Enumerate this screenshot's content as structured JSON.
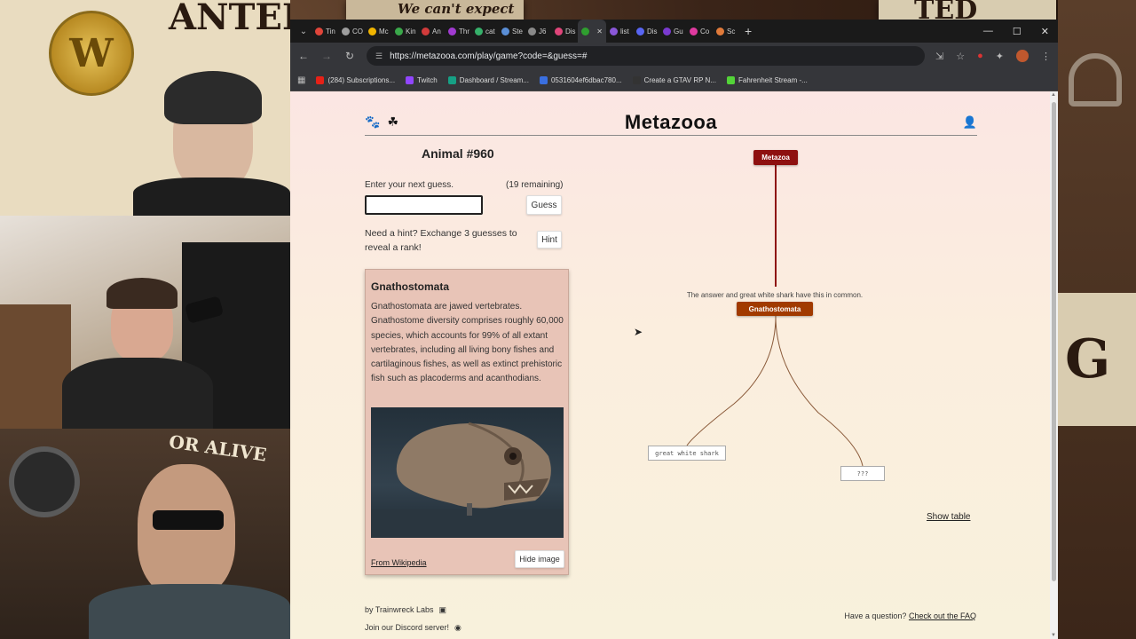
{
  "overlay": {
    "poster_text_top": "ANTED",
    "poster_text_top_right": "TED",
    "sign_text": "We can't expect",
    "poster_text_bottom": "OR ALIVE",
    "poster_text_side": "G",
    "badge_text": "W"
  },
  "browser": {
    "tabs": [
      {
        "label": "Tin",
        "color": "#e0453a"
      },
      {
        "label": "CO",
        "color": "#9e9e9e"
      },
      {
        "label": "Mc",
        "color": "#f0b400"
      },
      {
        "label": "Kin",
        "color": "#3aa84a"
      },
      {
        "label": "An",
        "color": "#d23b3b"
      },
      {
        "label": "Thr",
        "color": "#a03ad0"
      },
      {
        "label": "cat",
        "color": "#36b06a"
      },
      {
        "label": "Ste",
        "color": "#5a8ed6"
      },
      {
        "label": "J6",
        "color": "#8a8a8a"
      },
      {
        "label": "Dis",
        "color": "#e0457a"
      },
      {
        "label": "",
        "color": "#2f9e2f",
        "active": true
      },
      {
        "label": "list",
        "color": "#8a57d8"
      },
      {
        "label": "Dis",
        "color": "#5865f2"
      },
      {
        "label": "Gu",
        "color": "#7a3ad0"
      },
      {
        "label": "Co",
        "color": "#e03aa0"
      },
      {
        "label": "Sc",
        "color": "#e07a3a"
      }
    ],
    "close_tab_glyph": "✕",
    "new_tab_glyph": "+",
    "url": "https://metazooa.com/play/game?code=&guess=#",
    "bookmarks": [
      {
        "label": "(284) Subscriptions...",
        "color": "#e62117"
      },
      {
        "label": "Twitch",
        "color": "#9146ff"
      },
      {
        "label": "Dashboard / Stream...",
        "color": "#16a085"
      },
      {
        "label": "0531604ef6dbac780...",
        "color": "#3a6fe0"
      },
      {
        "label": "Create a GTAV RP N...",
        "color": "#333333"
      },
      {
        "label": "Fahrenheit Stream -...",
        "color": "#53d338"
      }
    ]
  },
  "site": {
    "logo": "Metazooa",
    "animal_title": "Animal #960",
    "guess_label": "Enter your next guess.",
    "remaining": "(19 remaining)",
    "guess_value": "",
    "guess_button": "Guess",
    "hint_text": "Need a hint? Exchange 3 guesses to reveal a rank!",
    "hint_button": "Hint",
    "card": {
      "title": "Gnathostomata",
      "description": "Gnathostomata are jawed vertebrates. Gnathostome diversity comprises roughly 60,000 species, which accounts for 99% of all extant vertebrates, including all living bony fishes and cartilaginous fishes, as well as extinct prehistoric fish such as placoderms and acanthodians.",
      "source_link": "From Wikipedia",
      "hide_button": "Hide image"
    },
    "tree": {
      "root": "Metazoa",
      "common_note": "The answer and great white shark have this in common.",
      "clade": "Gnathostomata",
      "leaf_guess": "great white shark",
      "leaf_unknown": "???"
    },
    "show_table": "Show table",
    "footer": {
      "credit": "by Trainwreck Labs",
      "discord": "Join our Discord server!",
      "question": "Have a question?",
      "faq_link": "Check out the FAQ"
    }
  },
  "colors": {
    "root_node": "#8e1010",
    "clade_node": "#a13a00",
    "branch_line": "#8e1010",
    "branch_curve": "#8a5a3a"
  }
}
